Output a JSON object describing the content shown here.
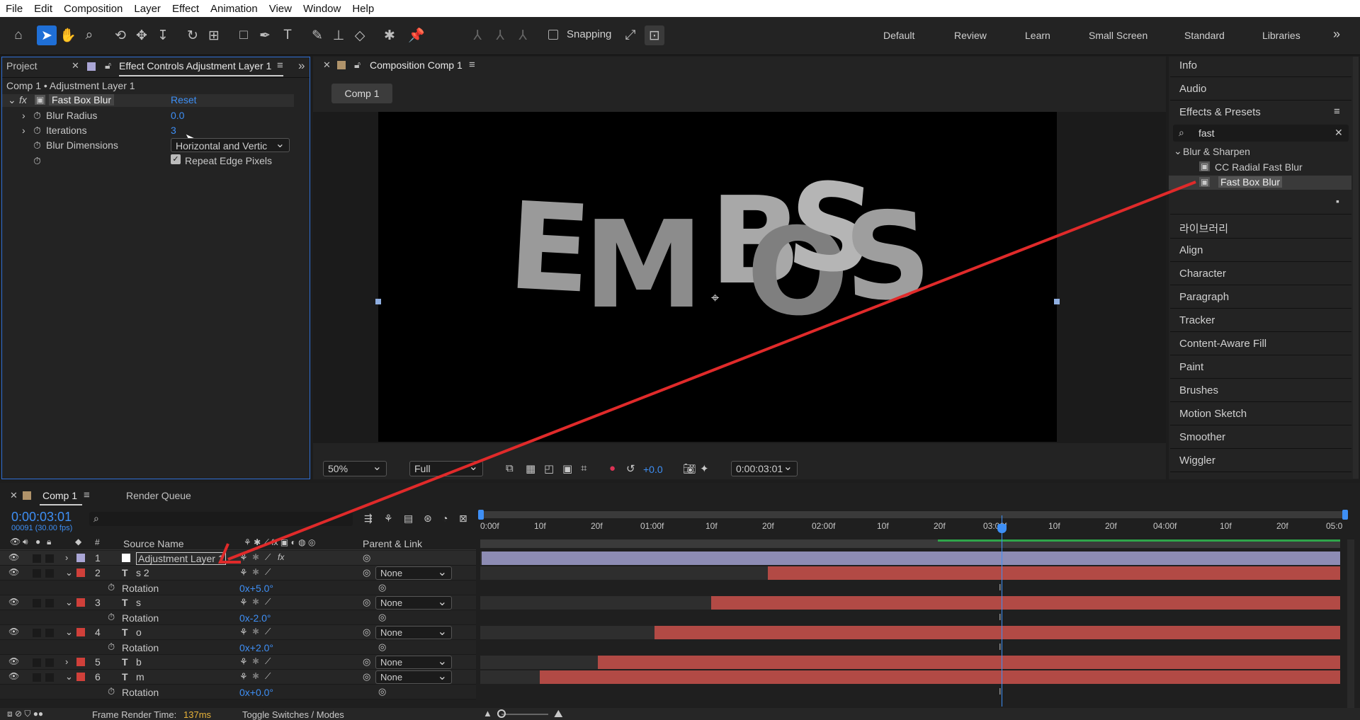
{
  "menu": [
    "File",
    "Edit",
    "Composition",
    "Layer",
    "Effect",
    "Animation",
    "View",
    "Window",
    "Help"
  ],
  "toolbar": {
    "snapping": "Snapping"
  },
  "workspaces": [
    "Default",
    "Review",
    "Learn",
    "Small Screen",
    "Standard",
    "Libraries"
  ],
  "left_panel": {
    "tab_project": "Project",
    "tab_effect_controls": "Effect Controls Adjustment Layer 1",
    "breadcrumb": "Comp 1 • Adjustment Layer 1",
    "effect_name": "Fast Box Blur",
    "reset": "Reset",
    "params": [
      {
        "label": "Blur Radius",
        "value": "0.0"
      },
      {
        "label": "Iterations",
        "value": "3"
      },
      {
        "label": "Blur Dimensions",
        "value": "Horizontal and Vertic"
      }
    ],
    "repeat_edge": "Repeat Edge Pixels"
  },
  "comp_panel": {
    "tab": "Composition Comp 1",
    "comp_button": "Comp 1",
    "canvas_text": [
      "E",
      "M",
      "B",
      "O",
      "S",
      "S"
    ],
    "zoom": "50%",
    "resolution": "Full",
    "exposure": "+0.0",
    "timecode": "0:00:03:01"
  },
  "right_panel": {
    "top_items": [
      "Info",
      "Audio"
    ],
    "effects_title": "Effects & Presets",
    "search_value": "fast",
    "category": "Blur & Sharpen",
    "results": [
      "CC Radial Fast Blur",
      "Fast Box Blur"
    ],
    "panels": [
      "라이브러리",
      "Align",
      "Character",
      "Paragraph",
      "Tracker",
      "Content-Aware Fill",
      "Paint",
      "Brushes",
      "Motion Sketch",
      "Smoother",
      "Wiggler"
    ]
  },
  "timeline": {
    "tab": "Comp 1",
    "render_queue": "Render Queue",
    "timecode": "0:00:03:01",
    "frames": "00091 (30.00 fps)",
    "col_source": "Source Name",
    "col_parent": "Parent & Link",
    "ruler": [
      "0:00f",
      "10f",
      "20f",
      "01:00f",
      "10f",
      "20f",
      "02:00f",
      "10f",
      "20f",
      "03:00f",
      "10f",
      "20f",
      "04:00f",
      "10f",
      "20f",
      "05:0"
    ],
    "layers": [
      {
        "num": "1",
        "name": "Adjustment Layer 1",
        "parent": ""
      },
      {
        "num": "2",
        "name": "s 2",
        "parent": "None",
        "prop": "Rotation",
        "val": "0x+5.0°"
      },
      {
        "num": "3",
        "name": "s",
        "parent": "None",
        "prop": "Rotation",
        "val": "0x-2.0°"
      },
      {
        "num": "4",
        "name": "o",
        "parent": "None",
        "prop": "Rotation",
        "val": "0x+2.0°"
      },
      {
        "num": "5",
        "name": "b",
        "parent": "None"
      },
      {
        "num": "6",
        "name": "m",
        "parent": "None",
        "prop": "Rotation",
        "val": "0x+0.0°"
      }
    ],
    "footer_render_label": "Frame Render Time:",
    "footer_render_value": "137ms",
    "footer_toggle": "Toggle Switches / Modes"
  },
  "colors": {
    "accent": "#3e8ff5",
    "annotation": "#e02a2a",
    "layer_text": "#b24a45",
    "layer_adjust": "#8d8cb4"
  }
}
